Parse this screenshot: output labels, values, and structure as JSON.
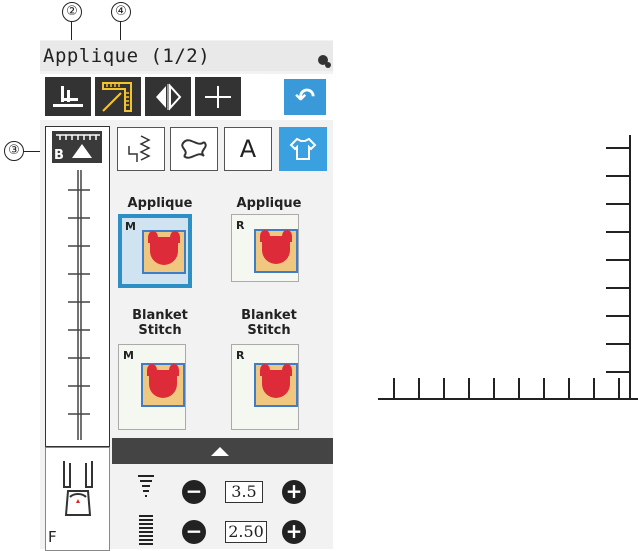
{
  "callouts": {
    "c2": "②",
    "c4": "④",
    "c3": "③"
  },
  "window": {
    "title": "Applique (1/2)"
  },
  "toolbar": {
    "back_symbol": "↶"
  },
  "scale": {
    "head_letter": "B"
  },
  "categories": {
    "text_symbol": "A"
  },
  "stitches": [
    {
      "label": "Applique",
      "letter": "M"
    },
    {
      "label": "Applique",
      "letter": "R"
    },
    {
      "label": "Blanket Stitch",
      "letter": "M"
    },
    {
      "label": "Blanket Stitch",
      "letter": "R"
    }
  ],
  "foot": {
    "letter": "F"
  },
  "settings": {
    "width_value": "3.5",
    "length_value": "2.50",
    "minus": "−",
    "plus": "+"
  },
  "colors": {
    "accent": "#3a9ad9",
    "selected": "#2d8fc4",
    "fabric": "#efc77e",
    "motif": "#dd2b3a"
  }
}
